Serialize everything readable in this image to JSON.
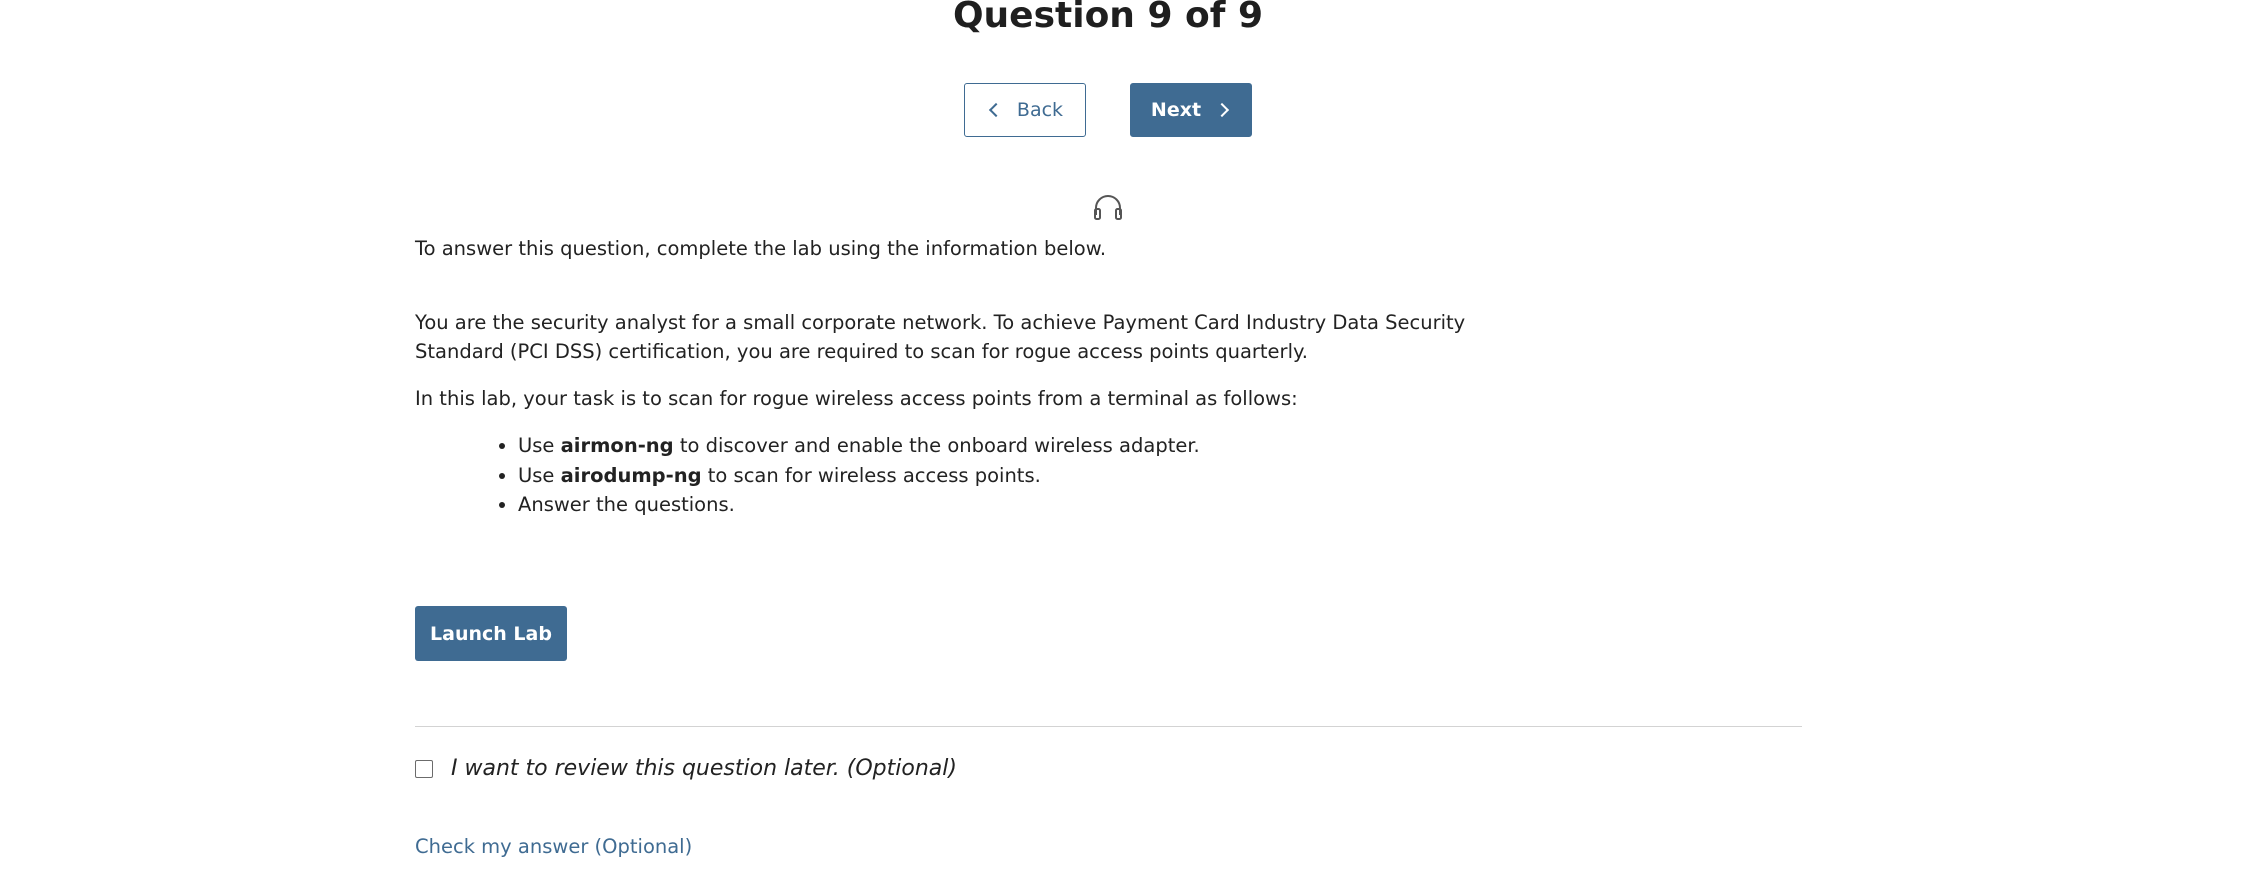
{
  "header": {
    "title": "Question 9 of 9"
  },
  "nav": {
    "back_label": "Back",
    "next_label": "Next"
  },
  "icons": {
    "audio": "headphones-icon",
    "back": "chevron-left-icon",
    "next": "chevron-right-icon"
  },
  "question": {
    "intro": "To answer this question, complete the lab using the information below.",
    "scenario": "You are the security analyst for a small corporate network. To achieve Payment Card Industry Data Security Standard (PCI DSS) certification, you are required to scan for rogue access points quarterly.",
    "task_intro": "In this lab, your task is to scan for rogue wireless access points from a terminal as follows:",
    "tasks": [
      {
        "prefix": "Use ",
        "bold": "airmon-ng",
        "suffix": " to discover and enable the onboard wireless adapter."
      },
      {
        "prefix": "Use ",
        "bold": "airodump-ng",
        "suffix": " to scan for wireless access points."
      },
      {
        "prefix": "",
        "bold": "",
        "suffix": "Answer the questions."
      }
    ]
  },
  "lab": {
    "launch_label": "Launch Lab"
  },
  "review": {
    "label": "I want to review this question later. (Optional)",
    "checked": false
  },
  "check_answer": {
    "label": "Check my answer (Optional)"
  },
  "colors": {
    "accent": "#3f6b92",
    "text": "#222222",
    "divider": "#d3d3d3"
  }
}
